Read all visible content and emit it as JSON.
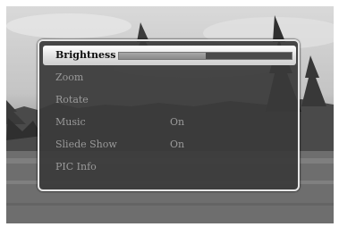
{
  "menu": {
    "items": [
      {
        "label": "Brightness",
        "value": "",
        "selected": true
      },
      {
        "label": "Zoom",
        "value": ""
      },
      {
        "label": "Rotate",
        "value": ""
      },
      {
        "label": "Music",
        "value": "On"
      },
      {
        "label": "Sliede Show",
        "value": "On"
      },
      {
        "label": "PIC Info",
        "value": ""
      }
    ],
    "brightness_level": 0.5
  },
  "colors": {
    "menu_background": "#3a3a3a",
    "selection": "#e0e0e0"
  }
}
